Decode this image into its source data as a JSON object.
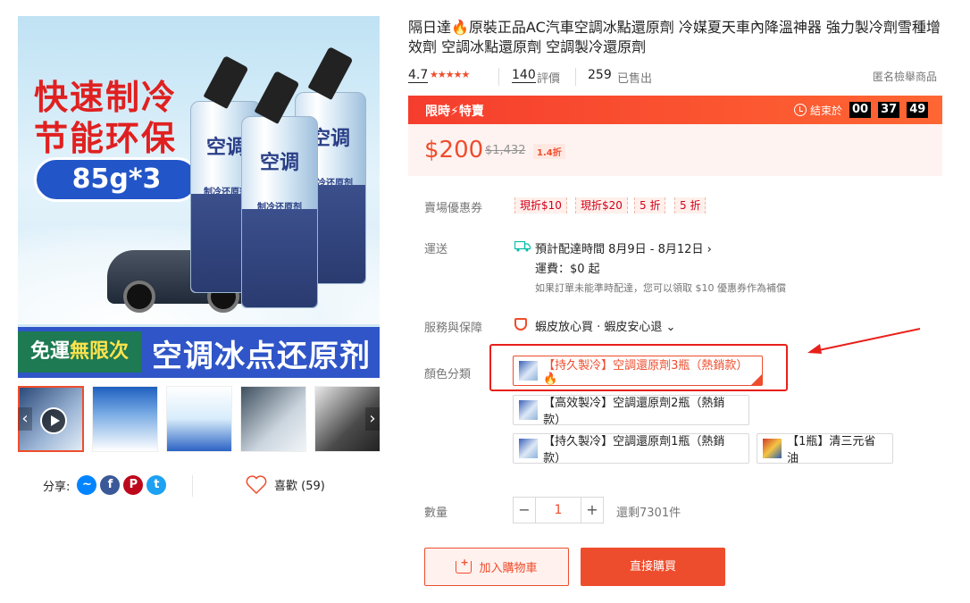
{
  "gallery": {
    "main_image": {
      "headline_1": "快速制冷",
      "headline_2": "节能环保",
      "badge": "85g*3",
      "can_title": "空调",
      "can_title_2": "制冷还原剂",
      "banner_text": "空调冰点还原剂",
      "free_ship_prefix": "免運",
      "free_ship_highlight": "無限次"
    },
    "thumbnails": [
      "thumb-1",
      "thumb-2",
      "thumb-3",
      "thumb-4",
      "thumb-5"
    ],
    "prev_arrow": "‹",
    "next_arrow": "›"
  },
  "share": {
    "label": "分享:",
    "icons": [
      "messenger-icon",
      "facebook-icon",
      "pinterest-icon",
      "twitter-icon"
    ]
  },
  "like": {
    "label": "喜歡 (59)"
  },
  "product": {
    "title": "隔日達🔥原裝正品AC汽車空調冰點還原劑 冷媒夏天車內降溫神器 強力製冷劑雪種增效劑 空調冰點還原劑 空調製冷還原劑",
    "rating": "4.7",
    "stars": "★★★★★",
    "reviews_count": "140",
    "reviews_label": "評價",
    "sold_count": "259",
    "sold_label": "已售出",
    "report_label": "匿名檢舉商品"
  },
  "flash_sale": {
    "label": "限時⚡特賣",
    "ends_label": "結束於",
    "hours": "00",
    "minutes": "37",
    "seconds": "49"
  },
  "price": {
    "current": "$200",
    "original": "$1,432",
    "discount": "1.4折"
  },
  "vouchers": {
    "label": "賣場優惠券",
    "items": [
      "現折$10",
      "現折$20",
      "5 折",
      "5 折"
    ]
  },
  "shipping": {
    "label": "運送",
    "eta": "預計配達時間 8月9日 - 8月12日 ›",
    "fee": "運費：$0 起",
    "note": "如果訂單未能準時配達，您可以領取 $10 優惠券作為補償"
  },
  "service": {
    "label": "服務與保障",
    "value": "蝦皮放心買 · 蝦皮安心退 ⌄"
  },
  "variations": {
    "label": "顏色分類",
    "options": [
      "【持久製冷】空調還原劑3瓶（熱銷款）🔥",
      "【高效製冷】空調還原劑2瓶（熱銷款）",
      "【持久製冷】空調還原劑1瓶（熱銷款）",
      "【1瓶】清三元省油"
    ],
    "selected": 0
  },
  "quantity": {
    "label": "數量",
    "value": "1",
    "minus": "−",
    "plus": "+",
    "stock": "還剩7301件"
  },
  "actions": {
    "add_to_cart": "加入購物車",
    "buy_now": "直接購買"
  },
  "colors": {
    "accent": "#ee4d2d",
    "flash_gradient_start": "#f53d2d",
    "price_bg": "#fef3f1",
    "annotation": "#e8201a"
  }
}
